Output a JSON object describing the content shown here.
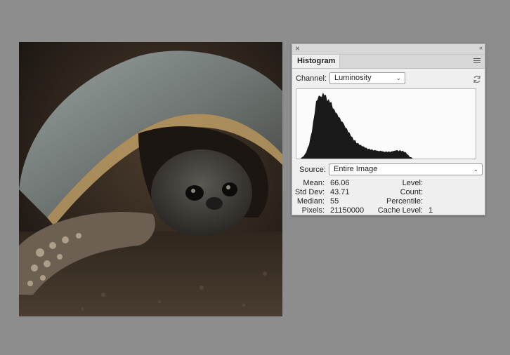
{
  "panel": {
    "tab_title": "Histogram",
    "channel_label": "Channel:",
    "channel_value": "Luminosity",
    "source_label": "Source:",
    "source_value": "Entire Image"
  },
  "icons": [
    "close-icon",
    "collapse-icon",
    "panel-menu-icon",
    "refresh-icon",
    "chevron-down-icon"
  ],
  "stats": {
    "mean_label": "Mean:",
    "mean_value": "66.06",
    "stddev_label": "Std Dev:",
    "stddev_value": "43.71",
    "median_label": "Median:",
    "median_value": "55",
    "pixels_label": "Pixels:",
    "pixels_value": "21150000",
    "level_label": "Level:",
    "level_value": "",
    "count_label": "Count:",
    "count_value": "",
    "percentile_label": "Percentile:",
    "percentile_value": "",
    "cache_label": "Cache Level:",
    "cache_value": "1"
  },
  "histogram": {
    "color": "#1a1a1a",
    "values": [
      0,
      0,
      0,
      1,
      2,
      4,
      6,
      10,
      15,
      22,
      30,
      40,
      52,
      66,
      80,
      85,
      88,
      90,
      86,
      95,
      88,
      92,
      80,
      86,
      78,
      82,
      70,
      72,
      64,
      66,
      58,
      60,
      52,
      54,
      48,
      46,
      42,
      40,
      36,
      34,
      30,
      28,
      26,
      24,
      22,
      20,
      19,
      18,
      17,
      16,
      15,
      14,
      14,
      13,
      13,
      12,
      12,
      12,
      11,
      11,
      11,
      11,
      10,
      10,
      10,
      10,
      10,
      10,
      10,
      11,
      11,
      12,
      12,
      11,
      12,
      11,
      11,
      10,
      9,
      7,
      5,
      3,
      2,
      1,
      0,
      0,
      0,
      0,
      0,
      0,
      0,
      0,
      0,
      0,
      0,
      0,
      0,
      0,
      0,
      0,
      0,
      0,
      0,
      0,
      0,
      0,
      0,
      0,
      0,
      0,
      0,
      0,
      0,
      0,
      0,
      0,
      0,
      0,
      0,
      0,
      0,
      0,
      0,
      0,
      0,
      0,
      0,
      0
    ]
  }
}
